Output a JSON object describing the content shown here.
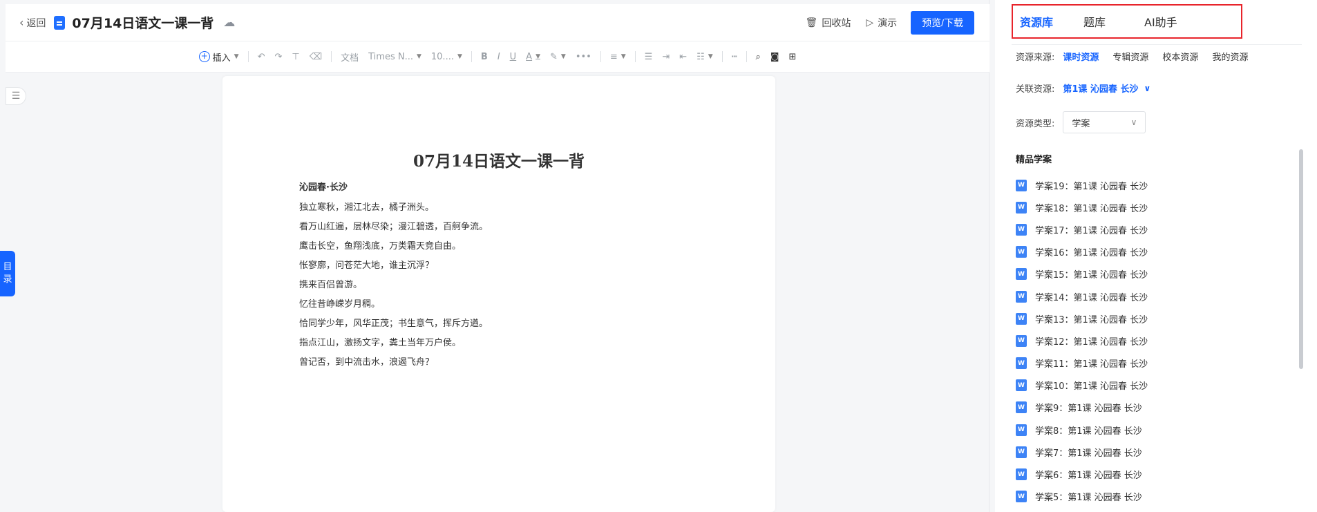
{
  "topbar": {
    "back_label": "返回",
    "doc_title": "07月14日语文一课一背",
    "recycle_label": "回收站",
    "present_label": "演示",
    "preview_download_label": "预览/下载"
  },
  "toolbar": {
    "insert_label": "插入",
    "style_value": "文档",
    "font_value": "Times N...",
    "size_value": "10...."
  },
  "sidebar": {
    "toc_label_1": "目",
    "toc_label_2": "录"
  },
  "document": {
    "title": "07月14日语文一课一背",
    "subtitle": "沁园春·长沙",
    "lines": [
      "独立寒秋，湘江北去，橘子洲头。",
      "看万山红遍，层林尽染；漫江碧透，百舸争流。",
      "鹰击长空，鱼翔浅底，万类霜天竞自由。",
      "怅寥廓，问苍茫大地，谁主沉浮？",
      "携来百侣曾游。",
      "忆往昔峥嵘岁月稠。",
      "恰同学少年，风华正茂；书生意气，挥斥方遒。",
      "指点江山，激扬文字，粪土当年万户侯。",
      "曾记否，到中流击水，浪遏飞舟？"
    ]
  },
  "panel": {
    "tabs": [
      "资源库",
      "题库",
      "AI助手"
    ],
    "source_label": "资源来源:",
    "sources": [
      "课时资源",
      "专辑资源",
      "校本资源",
      "我的资源"
    ],
    "related_label": "关联资源:",
    "related_value": "第1课 沁园春 长沙",
    "type_label": "资源类型:",
    "type_value": "学案",
    "section_title": "精品学案",
    "items": [
      "学案19：第1课 沁园春 长沙",
      "学案18：第1课 沁园春 长沙",
      "学案17：第1课 沁园春 长沙",
      "学案16：第1课 沁园春 长沙",
      "学案15：第1课 沁园春 长沙",
      "学案14：第1课 沁园春 长沙",
      "学案13：第1课 沁园春 长沙",
      "学案12：第1课 沁园春 长沙",
      "学案11：第1课 沁园春 长沙",
      "学案10：第1课 沁园春 长沙",
      "学案9：第1课 沁园春 长沙",
      "学案8：第1课 沁园春 长沙",
      "学案7：第1课 沁园春 长沙",
      "学案6：第1课 沁园春 长沙",
      "学案5：第1课 沁园春 长沙"
    ]
  },
  "colors": {
    "accent": "#1664ff",
    "highlight_border": "#e8242b"
  }
}
